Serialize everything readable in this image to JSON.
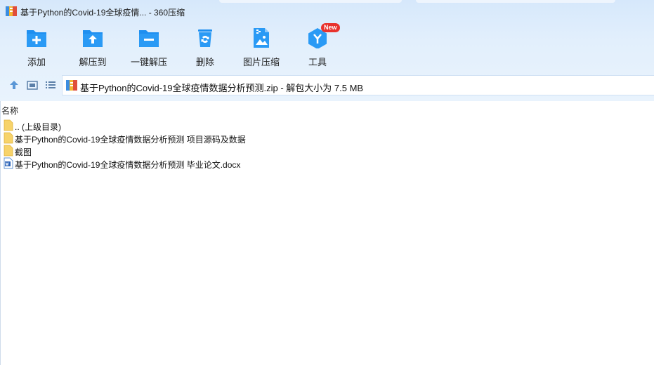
{
  "window": {
    "title": "基于Python的Covid-19全球疫情... - 360压缩",
    "app_icon": "archive-icon"
  },
  "toolbar": {
    "items": [
      {
        "label": "添加",
        "icon": "add-folder-icon"
      },
      {
        "label": "解压到",
        "icon": "extract-to-folder-icon"
      },
      {
        "label": "一键解压",
        "icon": "one-click-extract-icon"
      },
      {
        "label": "删除",
        "icon": "recycle-bin-icon"
      },
      {
        "label": "图片压缩",
        "icon": "image-compress-icon"
      },
      {
        "label": "工具",
        "icon": "tools-icon",
        "badge": "New"
      }
    ]
  },
  "nav": {
    "up_icon": "arrow-up-icon",
    "thumbnail_icon": "thumbnail-view-icon",
    "list_icon": "list-view-icon",
    "address": "基于Python的Covid-19全球疫情数据分析预测.zip - 解包大小为 7.5 MB"
  },
  "list": {
    "column_name": "名称",
    "files": [
      {
        "name": ".. (上级目录)",
        "icon": "parent-folder-icon"
      },
      {
        "name": "基于Python的Covid-19全球疫情数据分析预测 项目源码及数据",
        "icon": "folder-icon"
      },
      {
        "name": "截图",
        "icon": "folder-icon"
      },
      {
        "name": "基于Python的Covid-19全球疫情数据分析预测 毕业论文.docx",
        "icon": "word-doc-icon"
      }
    ]
  },
  "colors": {
    "accent": "#1e8ff0",
    "header_bg": "#dcebfb",
    "folder": "#f7c948",
    "badge": "#e8322d"
  }
}
